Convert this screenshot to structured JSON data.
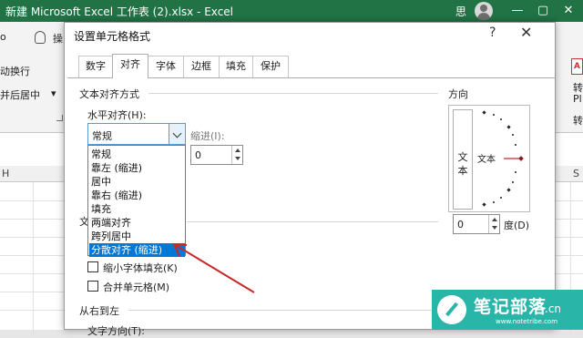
{
  "window": {
    "title": "新建 Microsoft Excel 工作表 (2).xlsx  -  Excel",
    "user": "思",
    "minimize": "—",
    "restore": "▢",
    "close": "✕"
  },
  "ribbon": {
    "left_clip_1": "o",
    "tell_me_clip": "操",
    "wrap_text_clip": "动换行",
    "merge_center_clip": "并后居中",
    "merge_center_arrow": "▾",
    "right_clip_top": "转",
    "right_clip_mid": "Pl",
    "right_clip_bottom": "转"
  },
  "grid": {
    "col_h": "H",
    "col_s": "S"
  },
  "dialog": {
    "title": "设置单元格格式",
    "help": "?",
    "close": "✕",
    "tabs": [
      "数字",
      "对齐",
      "字体",
      "边框",
      "填充",
      "保护"
    ],
    "active_tab": "对齐",
    "text_alignment_heading": "文本对齐方式",
    "horizontal_label": "水平对齐(H):",
    "horizontal_value": "常规",
    "indent_label": "缩进(I):",
    "indent_value": "0",
    "dropdown_options": [
      "常规",
      "靠左 (缩进)",
      "居中",
      "靠右 (缩进)",
      "填充",
      "两端对齐",
      "跨列居中",
      "分散对齐 (缩进)"
    ],
    "selected_option": "分散对齐 (缩进)",
    "text_control_clip": "文",
    "shrink_to_fit": "缩小字体填充(K)",
    "merge_cells": "合并单元格(M)",
    "rtl_heading": "从右到左",
    "text_direction_clip": "文字方向(T):",
    "orientation_heading": "方向",
    "orientation_vertical_text": "文本",
    "orientation_text": "文本",
    "degrees_value": "0",
    "degrees_label": "度(D)"
  },
  "watermark": {
    "title": "笔记部落",
    "domain": ".cn",
    "url": "www.notetribe.com"
  },
  "colors": {
    "excel_green": "#217346",
    "selection_blue": "#0078d7",
    "arrow_red": "#c8282a",
    "watermark_teal": "#29b6a8"
  }
}
